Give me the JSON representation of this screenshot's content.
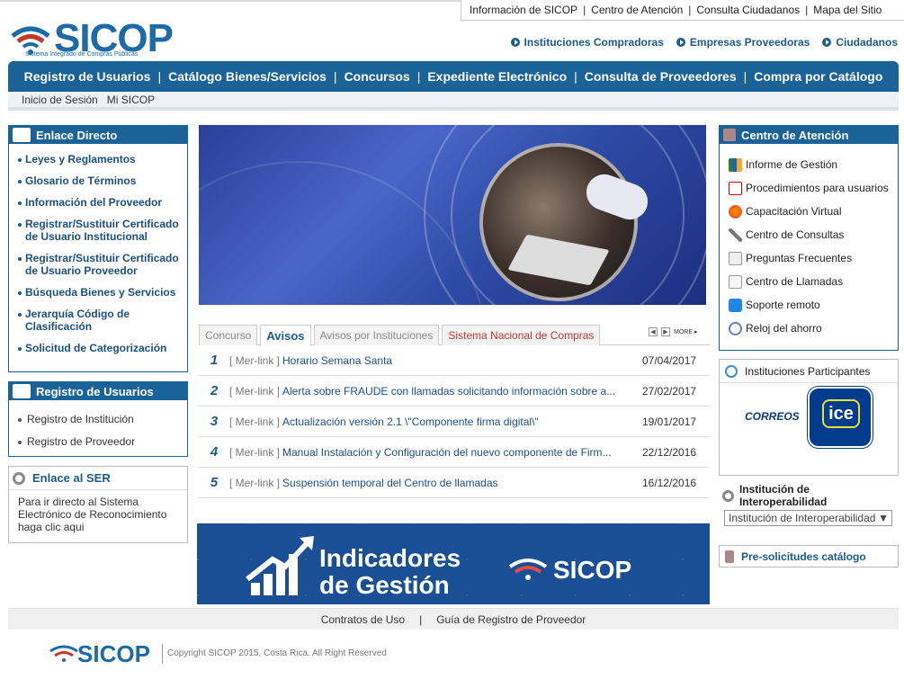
{
  "util_links": [
    "Información de SICOP",
    "Centro de Atención",
    "Consulta Ciudadanos",
    "Mapa del Sitio"
  ],
  "logo": {
    "name": "SICOP",
    "tagline": "Sistema Integrado de Compras Públicas"
  },
  "portal_links": [
    "Instituciones Compradoras",
    "Empresas Proveedoras",
    "Ciudadanos"
  ],
  "main_nav": [
    "Registro de Usuarios",
    "Catálogo Bienes/Servicios",
    "Concursos",
    "Expediente Electrónico",
    "Consulta de Proveedores",
    "Compra por Catálogo"
  ],
  "sub_nav": [
    "Inicio de Sesión",
    "Mi SICOP"
  ],
  "enlace": {
    "title": "Enlace Directo",
    "items": [
      "Leyes y Reglamentos",
      "Glosario de Términos",
      "Información del Proveedor",
      "Registrar/Sustituir Certificado de Usuario Institucional",
      "Registrar/Sustituir Certificado de Usuario Proveedor",
      "Búsqueda Bienes y Servicios",
      "Jerarquía Código de Clasificación",
      "Solicitud de Categorización"
    ]
  },
  "registro": {
    "title": "Registro de Usuarios",
    "items": [
      "Registro de Institución",
      "Registro de Proveedor"
    ]
  },
  "ser": {
    "title": "Enlace al SER",
    "text": "Para ir directo al Sistema Electrónico de Reconocimiento haga clic aqui"
  },
  "tabs": [
    {
      "label": "Concurso",
      "active": false
    },
    {
      "label": "Avisos",
      "active": true
    },
    {
      "label": "Avisos por Instituciones",
      "active": false
    },
    {
      "label": "Sistema Nacional de Compras",
      "active": false
    }
  ],
  "more_label": "MORE",
  "news": [
    {
      "num": "1",
      "tag": "[ Mer-link ]",
      "title": "Horario Semana Santa",
      "date": "07/04/2017"
    },
    {
      "num": "2",
      "tag": "[ Mer-link ]",
      "title": "Alerta sobre FRAUDE con llamadas solicitando información sobre a...",
      "date": "27/02/2017"
    },
    {
      "num": "3",
      "tag": "[ Mer-link ]",
      "title": "Actualización versión 2.1 \\\"Componente firma digital\\\"",
      "date": "19/01/2017"
    },
    {
      "num": "4",
      "tag": "[ Mer-link ]",
      "title": "Manual Instalación y Configuración del nuevo componente de Firm...",
      "date": "22/12/2016"
    },
    {
      "num": "5",
      "tag": "[ Mer-link ]",
      "title": "Suspensión temporal del Centro de llamadas",
      "date": "16/12/2016"
    }
  ],
  "indicadores": {
    "line1": "Indicadores",
    "line2": "de Gestión",
    "logo": "SICOP"
  },
  "atencion": {
    "title": "Centro de Atención",
    "items": [
      "Informe de Gestión",
      "Procedimientos para usuarios",
      "Capacitación Virtual",
      "Centro de Consultas",
      "Preguntas Frecuentes",
      "Centro de Llamadas",
      "Soporte remoto",
      "Reloj del ahorro"
    ]
  },
  "participantes": {
    "title": "Instituciones Participantes",
    "correos": "CORREOS",
    "ice": "ice"
  },
  "interop": {
    "title": "Institución de Interoperabilidad",
    "select": "Institución de Interoperabilidad"
  },
  "presol": "Pre-solicitudes catálogo",
  "footer": {
    "links": [
      "Contratos de Uso",
      "Guía de Registro de Proveedor"
    ],
    "logo": "SICOP",
    "copyright": "Copyright SICOP 2015, Costa Rica. All Right Reserved"
  },
  "colors": {
    "primary": "#1a6298",
    "link": "#1c5a8c",
    "alert": "#c0392b"
  }
}
